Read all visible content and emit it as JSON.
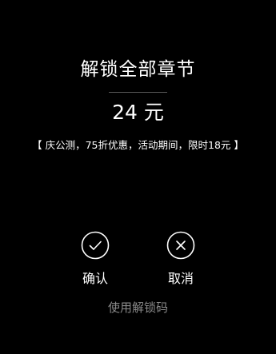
{
  "dialog": {
    "title": "解锁全部章节",
    "price": "24 元",
    "promo": "【 庆公测，75折优惠，活动期间，限时18元 】",
    "confirm_label": "确认",
    "cancel_label": "取消",
    "unlock_code_link": "使用解锁码"
  },
  "icons": {
    "confirm": "check-circle-icon",
    "cancel": "close-circle-icon"
  },
  "colors": {
    "background": "#000000",
    "text": "#ffffff",
    "muted": "#8a8a8a",
    "divider": "#5a5a5a"
  }
}
